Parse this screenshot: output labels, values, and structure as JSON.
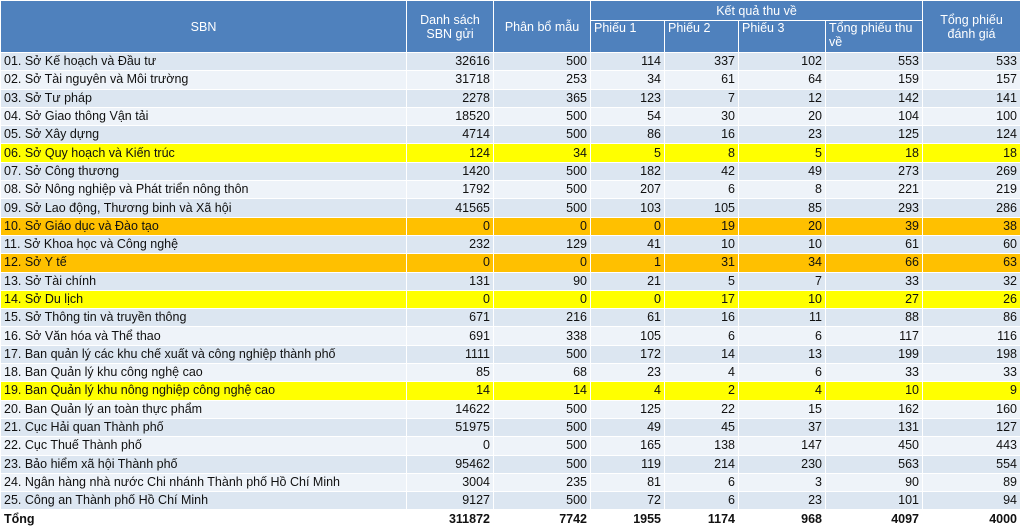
{
  "header": {
    "sbn": "SBN",
    "danh_sach": "Danh sách SBN gửi",
    "phan_bo": "Phân bổ mẫu",
    "ket_qua": "Kết quả thu về",
    "phieu1": "Phiếu 1",
    "phieu2": "Phiếu 2",
    "phieu3": "Phiếu 3",
    "tong_thu": "Tổng phiếu thu về",
    "tong_danh_gia": "Tổng phiếu đánh giá"
  },
  "rows": [
    {
      "name": "01. Sở Kế hoạch và Đầu tư",
      "ds": "32616",
      "pb": "500",
      "p1": "114",
      "p2": "337",
      "p3": "102",
      "tt": "553",
      "dg": "533",
      "highlight": ""
    },
    {
      "name": "02. Sở Tài nguyên và Môi trường",
      "ds": "31718",
      "pb": "253",
      "p1": "34",
      "p2": "61",
      "p3": "64",
      "tt": "159",
      "dg": "157",
      "highlight": ""
    },
    {
      "name": "03. Sở Tư pháp",
      "ds": "2278",
      "pb": "365",
      "p1": "123",
      "p2": "7",
      "p3": "12",
      "tt": "142",
      "dg": "141",
      "highlight": ""
    },
    {
      "name": "04. Sở Giao thông Vận tải",
      "ds": "18520",
      "pb": "500",
      "p1": "54",
      "p2": "30",
      "p3": "20",
      "tt": "104",
      "dg": "100",
      "highlight": ""
    },
    {
      "name": "05. Sở Xây dựng",
      "ds": "4714",
      "pb": "500",
      "p1": "86",
      "p2": "16",
      "p3": "23",
      "tt": "125",
      "dg": "124",
      "highlight": ""
    },
    {
      "name": "06. Sở Quy hoạch và Kiến trúc",
      "ds": "124",
      "pb": "34",
      "p1": "5",
      "p2": "8",
      "p3": "5",
      "tt": "18",
      "dg": "18",
      "highlight": "yellow"
    },
    {
      "name": "07. Sở Công thương",
      "ds": "1420",
      "pb": "500",
      "p1": "182",
      "p2": "42",
      "p3": "49",
      "tt": "273",
      "dg": "269",
      "highlight": ""
    },
    {
      "name": "08. Sở Nông nghiệp và Phát triển nông thôn",
      "ds": "1792",
      "pb": "500",
      "p1": "207",
      "p2": "6",
      "p3": "8",
      "tt": "221",
      "dg": "219",
      "highlight": ""
    },
    {
      "name": "09. Sở Lao động, Thương binh và Xã hội",
      "ds": "41565",
      "pb": "500",
      "p1": "103",
      "p2": "105",
      "p3": "85",
      "tt": "293",
      "dg": "286",
      "highlight": ""
    },
    {
      "name": "10. Sở Giáo dục và Đào tạo",
      "ds": "0",
      "pb": "0",
      "p1": "0",
      "p2": "19",
      "p3": "20",
      "tt": "39",
      "dg": "38",
      "highlight": "orange"
    },
    {
      "name": "11. Sở Khoa học và Công nghệ",
      "ds": "232",
      "pb": "129",
      "p1": "41",
      "p2": "10",
      "p3": "10",
      "tt": "61",
      "dg": "60",
      "highlight": ""
    },
    {
      "name": "12. Sở Y tế",
      "ds": "0",
      "pb": "0",
      "p1": "1",
      "p2": "31",
      "p3": "34",
      "tt": "66",
      "dg": "63",
      "highlight": "orange"
    },
    {
      "name": "13. Sở Tài chính",
      "ds": "131",
      "pb": "90",
      "p1": "21",
      "p2": "5",
      "p3": "7",
      "tt": "33",
      "dg": "32",
      "highlight": ""
    },
    {
      "name": "14. Sở Du lịch",
      "ds": "0",
      "pb": "0",
      "p1": "0",
      "p2": "17",
      "p3": "10",
      "tt": "27",
      "dg": "26",
      "highlight": "yellow"
    },
    {
      "name": "15. Sở Thông tin và truyền thông",
      "ds": "671",
      "pb": "216",
      "p1": "61",
      "p2": "16",
      "p3": "11",
      "tt": "88",
      "dg": "86",
      "highlight": ""
    },
    {
      "name": "16. Sở Văn hóa và Thể thao",
      "ds": "691",
      "pb": "338",
      "p1": "105",
      "p2": "6",
      "p3": "6",
      "tt": "117",
      "dg": "116",
      "highlight": ""
    },
    {
      "name": "17. Ban quản lý các khu chế xuất và công nghiệp thành phố",
      "ds": "1111",
      "pb": "500",
      "p1": "172",
      "p2": "14",
      "p3": "13",
      "tt": "199",
      "dg": "198",
      "highlight": ""
    },
    {
      "name": "18. Ban Quản lý khu công nghệ cao",
      "ds": "85",
      "pb": "68",
      "p1": "23",
      "p2": "4",
      "p3": "6",
      "tt": "33",
      "dg": "33",
      "highlight": ""
    },
    {
      "name": "19. Ban Quản lý khu nông nghiệp công nghệ cao",
      "ds": "14",
      "pb": "14",
      "p1": "4",
      "p2": "2",
      "p3": "4",
      "tt": "10",
      "dg": "9",
      "highlight": "yellow"
    },
    {
      "name": "20. Ban Quản lý an toàn thực phẩm",
      "ds": "14622",
      "pb": "500",
      "p1": "125",
      "p2": "22",
      "p3": "15",
      "tt": "162",
      "dg": "160",
      "highlight": ""
    },
    {
      "name": "21. Cục Hải quan Thành phố",
      "ds": "51975",
      "pb": "500",
      "p1": "49",
      "p2": "45",
      "p3": "37",
      "tt": "131",
      "dg": "127",
      "highlight": ""
    },
    {
      "name": "22. Cục Thuế Thành phố",
      "ds": "0",
      "pb": "500",
      "p1": "165",
      "p2": "138",
      "p3": "147",
      "tt": "450",
      "dg": "443",
      "highlight": ""
    },
    {
      "name": "23. Bảo hiểm xã hội Thành phố",
      "ds": "95462",
      "pb": "500",
      "p1": "119",
      "p2": "214",
      "p3": "230",
      "tt": "563",
      "dg": "554",
      "highlight": ""
    },
    {
      "name": "24. Ngân hàng nhà nước Chi nhánh Thành phố Hồ Chí Minh",
      "ds": "3004",
      "pb": "235",
      "p1": "81",
      "p2": "6",
      "p3": "3",
      "tt": "90",
      "dg": "89",
      "highlight": ""
    },
    {
      "name": "25. Công an Thành phố Hồ Chí Minh",
      "ds": "9127",
      "pb": "500",
      "p1": "72",
      "p2": "6",
      "p3": "23",
      "tt": "101",
      "dg": "94",
      "highlight": ""
    }
  ],
  "total": {
    "name": "Tổng",
    "ds": "311872",
    "pb": "7742",
    "p1": "1955",
    "p2": "1174",
    "p3": "968",
    "tt": "4097",
    "dg": "4000"
  }
}
